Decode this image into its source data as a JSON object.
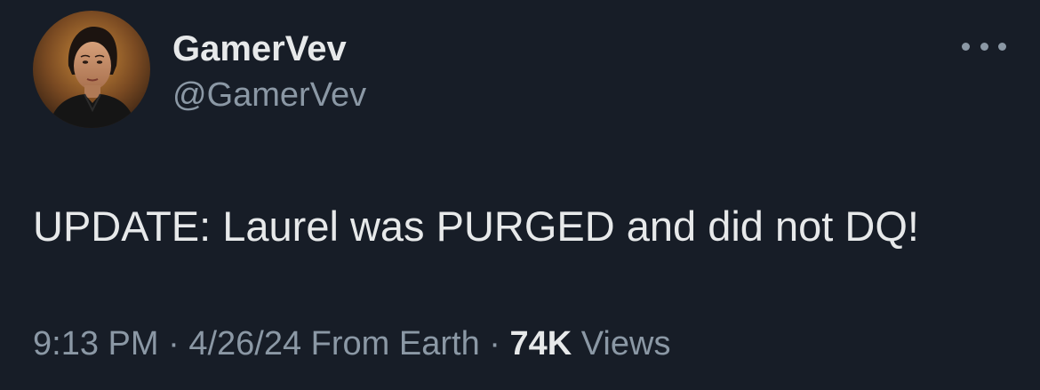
{
  "author": {
    "display_name": "GamerVev",
    "handle": "@GamerVev",
    "avatar_icon": "profile-photo"
  },
  "tweet": {
    "text": "UPDATE: Laurel was PURGED and did not DQ!"
  },
  "meta": {
    "time": "9:13 PM",
    "separator_1": " · ",
    "date": "4/26/24",
    "source": " From Earth",
    "separator_2": " · ",
    "views_count": "74K",
    "views_label": " Views"
  },
  "menu": {
    "icon": "more-horizontal-icon"
  },
  "colors": {
    "background": "#171d27",
    "primary_text": "#e7e9ea",
    "secondary_text": "#8b98a5"
  }
}
